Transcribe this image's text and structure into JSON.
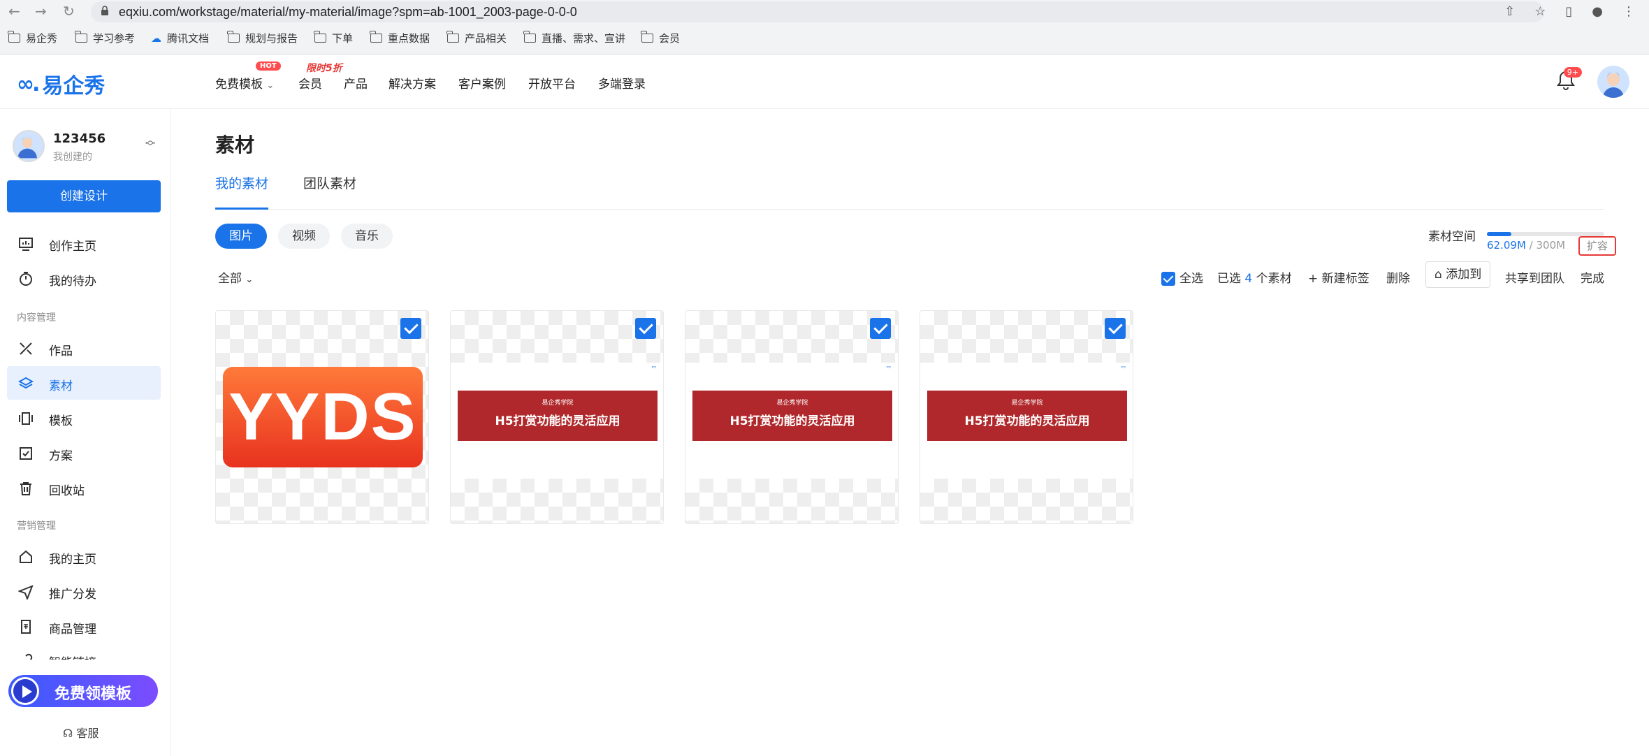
{
  "browser": {
    "url": "eqxiu.com/workstage/material/my-material/image?spm=ab-1001_2003-page-0-0-0",
    "bookmarks": [
      "易企秀",
      "学习参考",
      "腾讯文档",
      "规划与报告",
      "下单",
      "重点数据",
      "产品相关",
      "直播、需求、宣讲",
      "会员"
    ]
  },
  "topnav": {
    "logo_text": "易企秀",
    "items": [
      "免费模板",
      "会员",
      "产品",
      "解决方案",
      "客户案例",
      "开放平台",
      "多端登录"
    ],
    "hot_badge": "HOT",
    "sale_badge": "限时5折",
    "notif_badge": "9+"
  },
  "sidebar": {
    "user_name": "123456",
    "user_sub": "我创建的",
    "create_button": "创建设计",
    "items_top": [
      "创作主页",
      "我的待办"
    ],
    "section_content": "内容管理",
    "items_content": [
      "作品",
      "素材",
      "模板",
      "方案",
      "回收站"
    ],
    "section_marketing": "营销管理",
    "items_marketing": [
      "我的主页",
      "推广分发",
      "商品管理",
      "智能链接"
    ],
    "promo": "免费领模板",
    "service": "客服"
  },
  "main": {
    "title": "素材",
    "tabs": [
      "我的素材",
      "团队素材"
    ],
    "pills": [
      "图片",
      "视频",
      "音乐"
    ],
    "storage_label": "素材空间",
    "storage_used": "62.09M",
    "storage_total": "300M",
    "storage_fraction": 0.207,
    "expand": "扩容",
    "filter": "全部",
    "select_all": "全选",
    "selected_prefix": "已选",
    "selected_count": "4",
    "selected_suffix": "个素材",
    "new_tag": "+ 新建标签",
    "delete": "删除",
    "add_to": "添加到",
    "share_team": "共享到团队",
    "done": "完成"
  },
  "cards": [
    {
      "type": "yyds",
      "text": "YYDS"
    },
    {
      "type": "banner",
      "small": "易企秀学院",
      "big": "H5打赏功能的灵活应用"
    },
    {
      "type": "banner",
      "small": "易企秀学院",
      "big": "H5打赏功能的灵活应用"
    },
    {
      "type": "banner",
      "small": "易企秀学院",
      "big": "H5打赏功能的灵活应用"
    }
  ],
  "colors": {
    "accent": "#1a73e8",
    "danger": "#e53935",
    "banner_red": "#b0282b"
  }
}
